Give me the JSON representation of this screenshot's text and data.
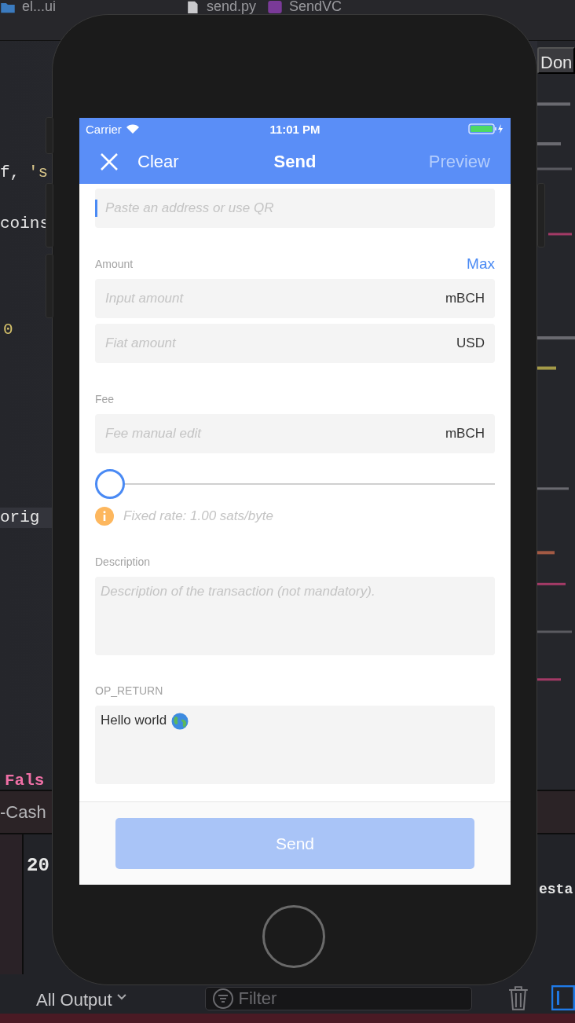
{
  "xcode": {
    "breadcrumbs": [
      {
        "label": "el...ui",
        "kind": "folder"
      },
      {
        "label": "send.py",
        "kind": "file"
      },
      {
        "label": "SendVC",
        "kind": "class"
      }
    ],
    "done_button": "Don",
    "code_fragments": [
      {
        "text": "f,",
        "kind": "plain"
      },
      {
        "text": "'s",
        "kind": "string"
      },
      {
        "text": "coins",
        "kind": "plain"
      },
      {
        "text": "0",
        "kind": "number"
      },
      {
        "text": "orig",
        "kind": "highlighted"
      },
      {
        "text": "Fals",
        "kind": "keyword"
      }
    ],
    "tab": "-Cash",
    "console": {
      "left_text": "20",
      "right_text": "esta"
    },
    "filter_bar": {
      "output_menu": "All Output",
      "filter_placeholder": "Filter"
    }
  },
  "phone": {
    "status_bar": {
      "carrier": "Carrier",
      "time": "11:01 PM"
    },
    "nav": {
      "close_label": "Clear",
      "title": "Send",
      "preview": {
        "label": "Preview",
        "disabled": true
      }
    },
    "address_field": {
      "placeholder": "Paste an address or use QR",
      "focused": true
    },
    "amount": {
      "label": "Amount",
      "max_link": "Max",
      "fields": [
        {
          "placeholder": "Input amount",
          "unit": "mBCH"
        },
        {
          "placeholder": "Fiat amount",
          "unit": "USD"
        }
      ]
    },
    "fee": {
      "label": "Fee",
      "field": {
        "placeholder": "Fee manual edit",
        "unit": "mBCH"
      },
      "slider": {
        "level": 0
      },
      "info": "Fixed rate: 1.00 sats/byte"
    },
    "description": {
      "label": "Description",
      "placeholder": "Description of the transaction (not mandatory)."
    },
    "op_return": {
      "label": "OP_RETURN",
      "value": "Hello world"
    },
    "send_button": {
      "label": "Send",
      "disabled": true
    }
  }
}
